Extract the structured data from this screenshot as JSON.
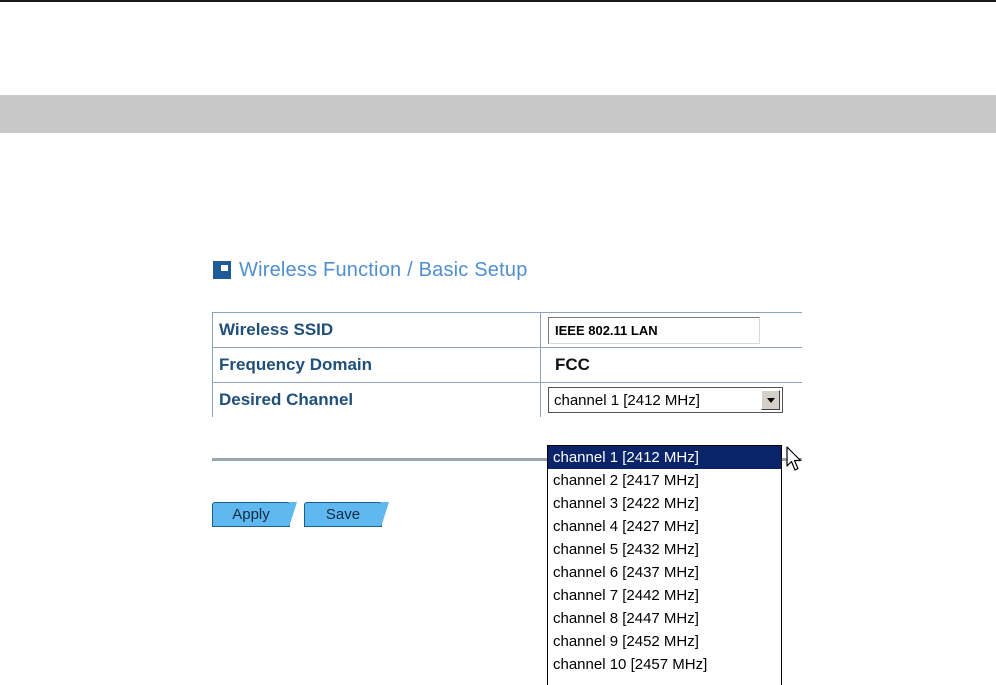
{
  "page": {
    "title": "Wireless Function / Basic Setup"
  },
  "settings": {
    "ssid": {
      "label": "Wireless SSID",
      "value": "IEEE 802.11 LAN"
    },
    "frequency": {
      "label": "Frequency Domain",
      "value": "FCC"
    },
    "channel": {
      "label": "Desired Channel",
      "selected": "channel 1 [2412 MHz]",
      "options": [
        "channel 1 [2412 MHz]",
        "channel 2 [2417 MHz]",
        "channel 3 [2422 MHz]",
        "channel 4 [2427 MHz]",
        "channel 5 [2432 MHz]",
        "channel 6 [2437 MHz]",
        "channel 7 [2442 MHz]",
        "channel 8 [2447 MHz]",
        "channel 9 [2452 MHz]",
        "channel 10 [2457 MHz]"
      ]
    }
  },
  "buttons": {
    "apply_label": "Apply",
    "save_label": "Save"
  },
  "colors": {
    "title": "#4f8fd0",
    "label": "#1f4f7a",
    "button": "#5fb8ef",
    "selection": "#0a246a",
    "band": "#c8c8c8"
  },
  "icons": {
    "title_icon": "page-icon",
    "select_arrow": "chevron-down-icon",
    "pointer": "mouse-cursor-icon"
  }
}
